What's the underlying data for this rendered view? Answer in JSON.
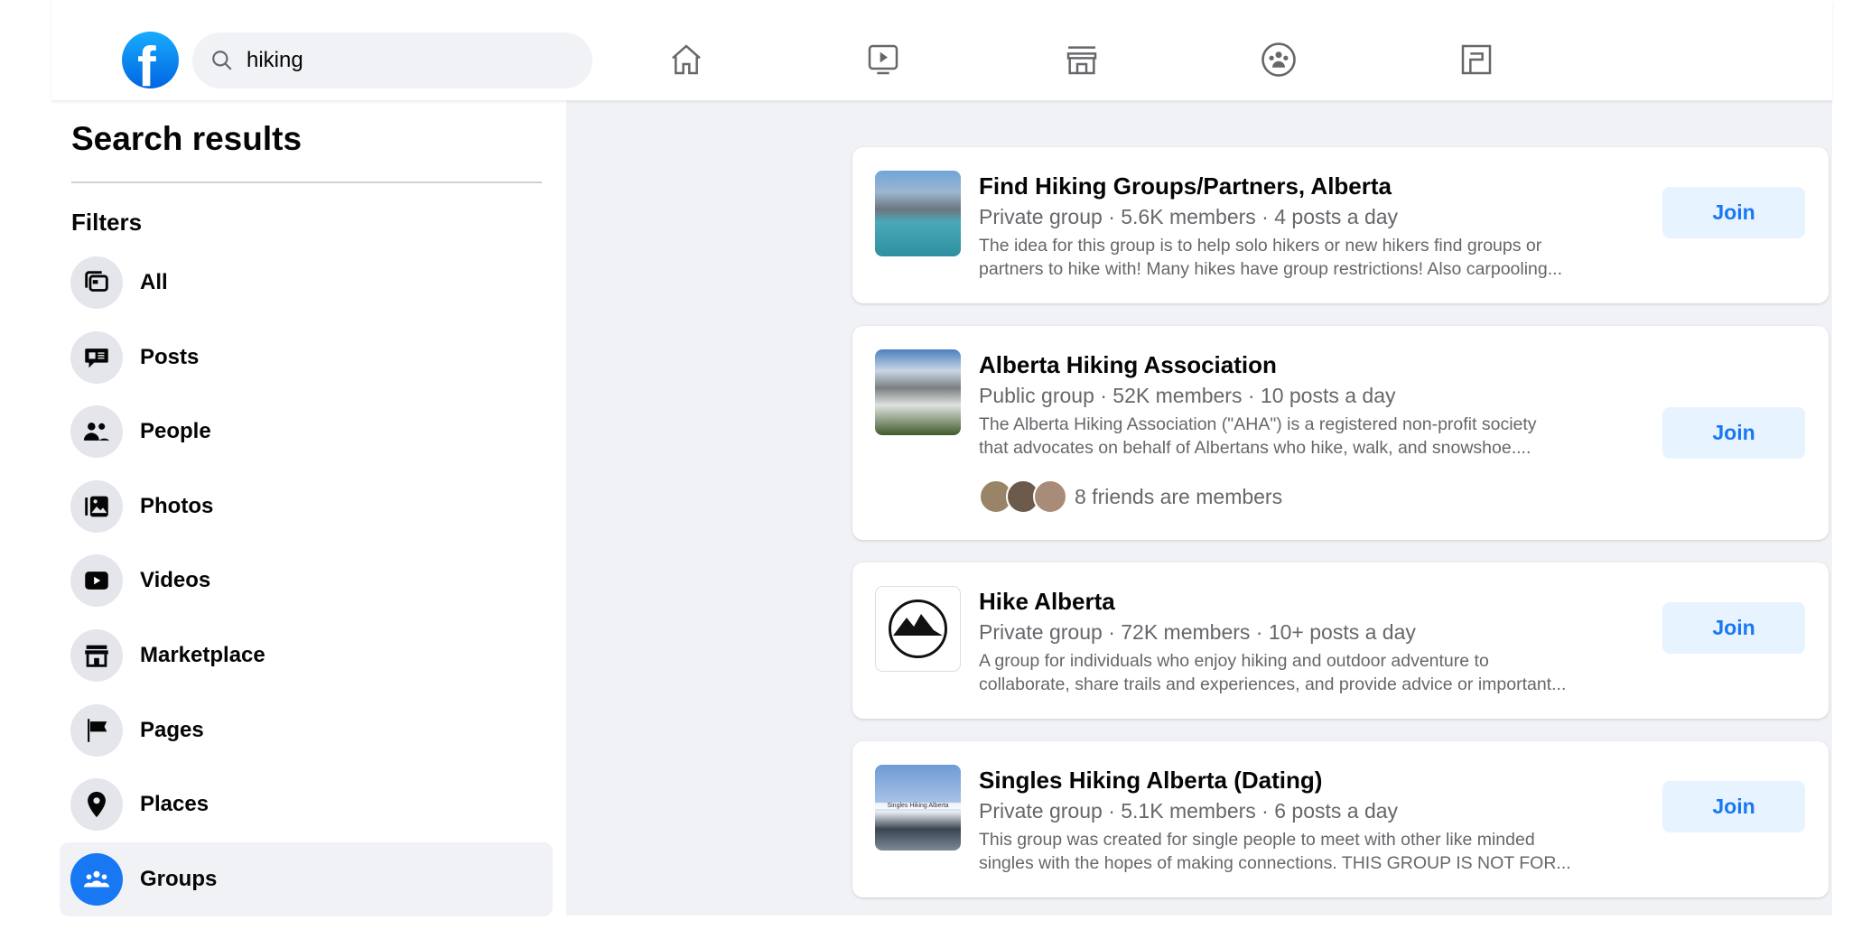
{
  "header": {
    "search_value": "hiking",
    "nav": [
      "home",
      "watch",
      "marketplace",
      "groups",
      "gaming"
    ]
  },
  "sidebar": {
    "title": "Search results",
    "filters_label": "Filters",
    "items": [
      {
        "label": "All",
        "icon": "all-icon"
      },
      {
        "label": "Posts",
        "icon": "posts-icon"
      },
      {
        "label": "People",
        "icon": "people-icon"
      },
      {
        "label": "Photos",
        "icon": "photos-icon"
      },
      {
        "label": "Videos",
        "icon": "videos-icon"
      },
      {
        "label": "Marketplace",
        "icon": "marketplace-icon"
      },
      {
        "label": "Pages",
        "icon": "pages-icon"
      },
      {
        "label": "Places",
        "icon": "places-icon"
      },
      {
        "label": "Groups",
        "icon": "groups-icon",
        "active": true
      }
    ]
  },
  "results": [
    {
      "title": "Find Hiking Groups/Partners, Alberta",
      "meta": "Private group · 5.6K members · 4 posts a day",
      "desc1": "The idea for this group is to help solo hikers or new hikers find groups or",
      "desc2": "partners to hike with! Many hikes have group restrictions! Also carpooling...",
      "join": "Join"
    },
    {
      "title": "Alberta Hiking Association",
      "meta": "Public group · 52K members · 10 posts a day",
      "desc1": "The Alberta Hiking Association (\"AHA\") is a registered non-profit society",
      "desc2": "that advocates on behalf of Albertans who hike, walk, and snowshoe....",
      "friends": "8 friends are members",
      "join": "Join"
    },
    {
      "title": "Hike Alberta",
      "meta": "Private group · 72K members · 10+ posts a day",
      "desc1": "A group for individuals who enjoy hiking and outdoor adventure to",
      "desc2": "collaborate, share trails and experiences, and provide advice or important...",
      "join": "Join"
    },
    {
      "title": "Singles Hiking Alberta (Dating)",
      "meta": "Private group · 5.1K members · 6 posts a day",
      "desc1": "This group was created for single people to meet with other like minded",
      "desc2": "singles with the hopes of making connections. THIS GROUP IS NOT FOR...",
      "thumb_text": "Singles Hiking Alberta",
      "join": "Join"
    }
  ],
  "colors": {
    "accent": "#1877f2",
    "join_bg": "#e7f3ff",
    "page_bg": "#f0f2f5"
  }
}
